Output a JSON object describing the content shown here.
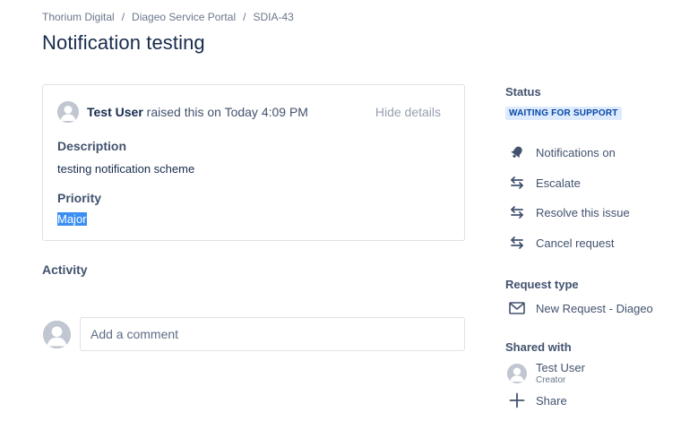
{
  "breadcrumb": {
    "items": [
      "Thorium Digital",
      "Diageo Service Portal",
      "SDIA-43"
    ],
    "separator": "/"
  },
  "page_title": "Notification testing",
  "request": {
    "reporter": "Test User",
    "raised_text": "raised this on Today 4:09 PM",
    "hide_details": "Hide details",
    "description_label": "Description",
    "description_value": "testing notification scheme",
    "priority_label": "Priority",
    "priority_value": "Major"
  },
  "activity": {
    "label": "Activity",
    "comment_placeholder": "Add a comment"
  },
  "sidebar": {
    "status_label": "Status",
    "status_value": "WAITING FOR SUPPORT",
    "actions": [
      {
        "label": "Notifications on",
        "icon": "bell-icon"
      },
      {
        "label": "Escalate",
        "icon": "transition-arrows-icon"
      },
      {
        "label": "Resolve this issue",
        "icon": "transition-arrows-icon"
      },
      {
        "label": "Cancel request",
        "icon": "transition-arrows-icon"
      }
    ],
    "request_type_label": "Request type",
    "request_type_value": "New Request - Diageo",
    "shared_with_label": "Shared with",
    "shared_user_name": "Test User",
    "shared_user_role": "Creator",
    "share_label": "Share"
  },
  "colors": {
    "status_bg": "#deebff",
    "status_text": "#0747a6",
    "selection": "#3b8ff2",
    "text_primary": "#172b4d",
    "text_secondary": "#42526e"
  }
}
